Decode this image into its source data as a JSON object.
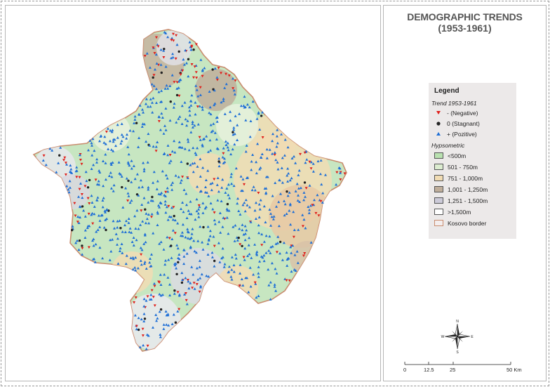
{
  "title_line1": "DEMOGRAPHIC TRENDS",
  "title_line2": "(1953-1961)",
  "legend": {
    "title": "Legend",
    "trend_heading": "Trend 1953-1961",
    "trend_items": [
      {
        "label": "- (Negative)",
        "symbol": "triangle-down",
        "color": "#e0201c"
      },
      {
        "label": "0 (Stagnant)",
        "symbol": "dot",
        "color": "#222222"
      },
      {
        "label": "+ (Pozitive)",
        "symbol": "triangle-up",
        "color": "#1f6fd6"
      }
    ],
    "hypsometric_heading": "Hypsometric",
    "hypsometric_items": [
      {
        "label": "<500m",
        "color": "#b9e1b0"
      },
      {
        "label": "501 - 750m",
        "color": "#dcecd0"
      },
      {
        "label": "751 - 1,000m",
        "color": "#f1dcb4"
      },
      {
        "label": "1,001 - 1,250m",
        "color": "#bfae9b"
      },
      {
        "label": "1,251 - 1,500m",
        "color": "#cccad8"
      },
      {
        "label": ">1,500m",
        "color": "#ffffff"
      }
    ],
    "border_item": {
      "label": "Kosovo border",
      "color": "#c98c6e"
    }
  },
  "compass_letters": [
    "N",
    "E",
    "S",
    "W"
  ],
  "scale": {
    "ticks": [
      "0",
      "12.5",
      "25",
      "50 Km"
    ]
  }
}
